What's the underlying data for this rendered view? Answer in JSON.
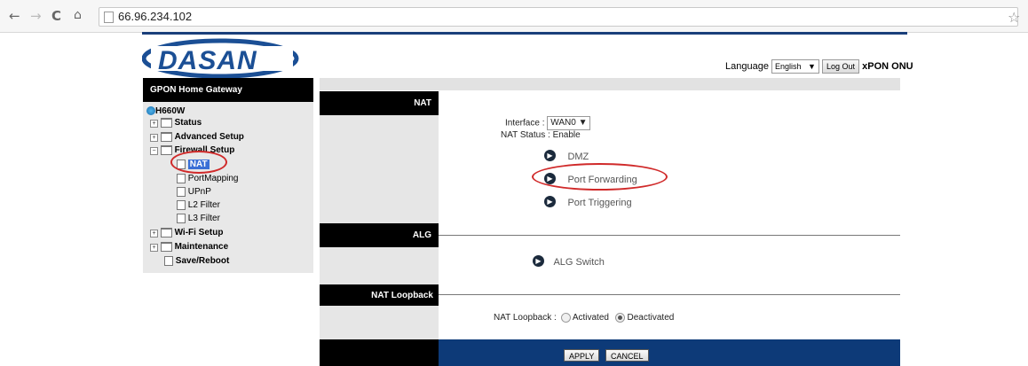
{
  "browser": {
    "back_icon": "back-arrow-icon",
    "url": "66.96.234.102"
  },
  "header": {
    "logo_text": "DASAN",
    "language_label": "Language",
    "language_value": "English",
    "logout_label": "Log Out",
    "product_label": "xPON ONU"
  },
  "sidebar": {
    "title": "GPON Home Gateway",
    "root": "H660W",
    "items": [
      {
        "label": "Status"
      },
      {
        "label": "Advanced Setup"
      },
      {
        "label": "Firewall Setup"
      },
      {
        "label": "NAT"
      },
      {
        "label": "PortMapping"
      },
      {
        "label": "UPnP"
      },
      {
        "label": "L2 Filter"
      },
      {
        "label": "L3 Filter"
      },
      {
        "label": "Wi-Fi Setup"
      },
      {
        "label": "Maintenance"
      },
      {
        "label": "Save/Reboot"
      }
    ]
  },
  "nat": {
    "section": "NAT",
    "interface_label": "Interface",
    "interface_value": "WAN0",
    "status_label": "NAT Status",
    "status_value": "Enable",
    "links": [
      "DMZ",
      "Port Forwarding",
      "Port Triggering"
    ]
  },
  "alg": {
    "section": "ALG",
    "link": "ALG Switch"
  },
  "loopback": {
    "section": "NAT Loopback",
    "label": "NAT Loopback",
    "options": [
      "Activated",
      "Deactivated"
    ],
    "selected": "Deactivated"
  },
  "buttons": {
    "apply": "APPLY",
    "cancel": "CANCEL"
  },
  "colors": {
    "brand_blue": "#0d3a78",
    "highlight_red": "#d02a2a"
  }
}
